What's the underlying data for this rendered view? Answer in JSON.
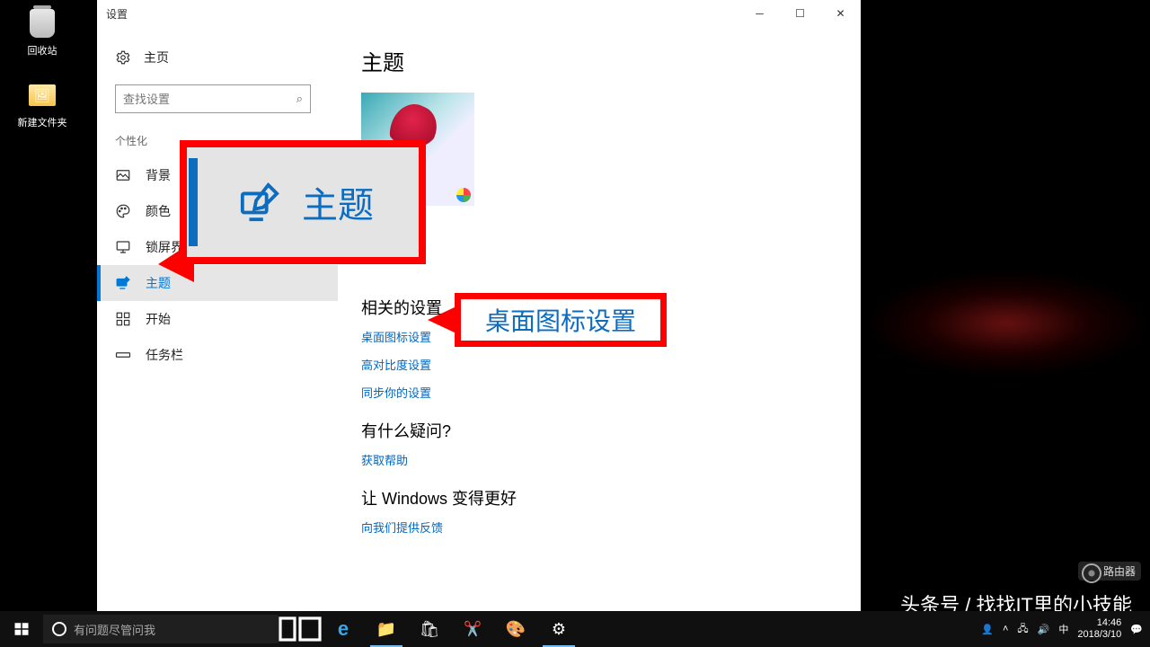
{
  "desktop": {
    "recycle_bin": "回收站",
    "new_folder": "新建文件夹"
  },
  "window": {
    "title": "设置",
    "home": "主页",
    "search_placeholder": "查找设置",
    "section": "个性化",
    "nav": {
      "background": "背景",
      "colors": "颜色",
      "lockscreen": "锁屏界面",
      "themes": "主题",
      "start": "开始",
      "taskbar": "任务栏"
    },
    "content": {
      "heading": "主题",
      "related_heading": "相关的设置",
      "link_desktop_icons": "桌面图标设置",
      "link_high_contrast": "高对比度设置",
      "link_sync": "同步你的设置",
      "questions_heading": "有什么疑问?",
      "link_help": "获取帮助",
      "feedback_heading": "让 Windows 变得更好",
      "link_feedback": "向我们提供反馈"
    }
  },
  "callouts": {
    "themes_big": "主题",
    "desktop_icons_big": "桌面图标设置"
  },
  "watermark": {
    "text": "头条号 / 找找IT里的小技能",
    "router": "路由器"
  },
  "taskbar": {
    "cortana_placeholder": "有问题尽管问我",
    "time": "14:46",
    "date": "2018/3/10"
  }
}
